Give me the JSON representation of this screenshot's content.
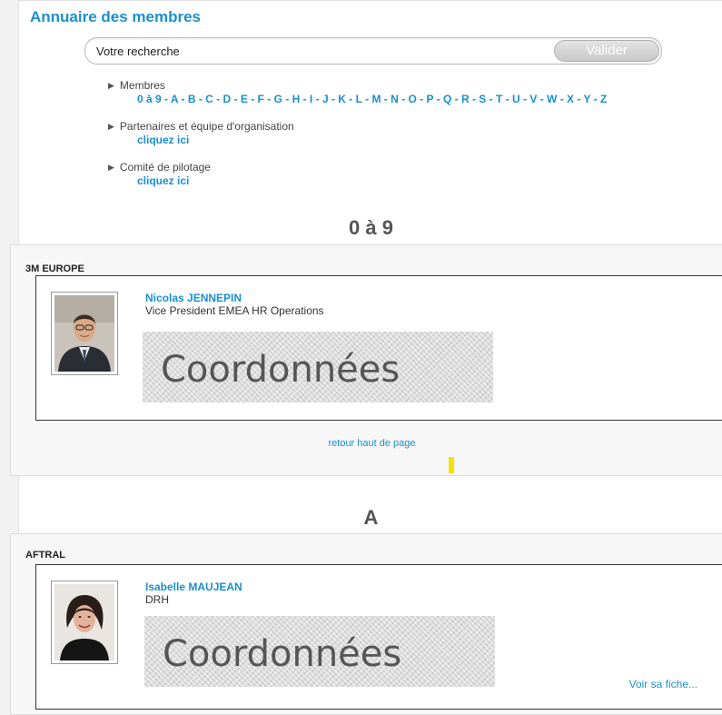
{
  "page": {
    "title": "Annuaire des membres"
  },
  "search": {
    "placeholder": "Votre recherche",
    "button_label": "Valider"
  },
  "nav": {
    "members_label": "Membres",
    "letters": [
      "0 à 9",
      "A",
      "B",
      "C",
      "D",
      "E",
      "F",
      "G",
      "H",
      "I",
      "J",
      "K",
      "L",
      "M",
      "N",
      "O",
      "P",
      "Q",
      "R",
      "S",
      "T",
      "U",
      "V",
      "W",
      "X",
      "Y",
      "Z"
    ],
    "partners_label": "Partenaires et équipe d'organisation",
    "partners_link": "cliquez ici",
    "committee_label": "Comité de pilotage",
    "committee_link": "cliquez ici"
  },
  "sections": [
    {
      "heading": "0 à 9",
      "group": "3M EUROPE",
      "member": {
        "name": "Nicolas JENNEPIN",
        "role": "Vice President EMEA HR Operations",
        "coords_label": "Coordonnées"
      },
      "back_top": "retour haut de page"
    },
    {
      "heading": "A",
      "group": "AFTRAL",
      "member": {
        "name": "Isabelle MAUJEAN",
        "role": "DRH",
        "coords_label": "Coordonnées",
        "more_link": "Voir sa fiche..."
      }
    }
  ],
  "colors": {
    "link": "#1a8fd1",
    "heading": "#555555",
    "marker": "#f5e000"
  }
}
